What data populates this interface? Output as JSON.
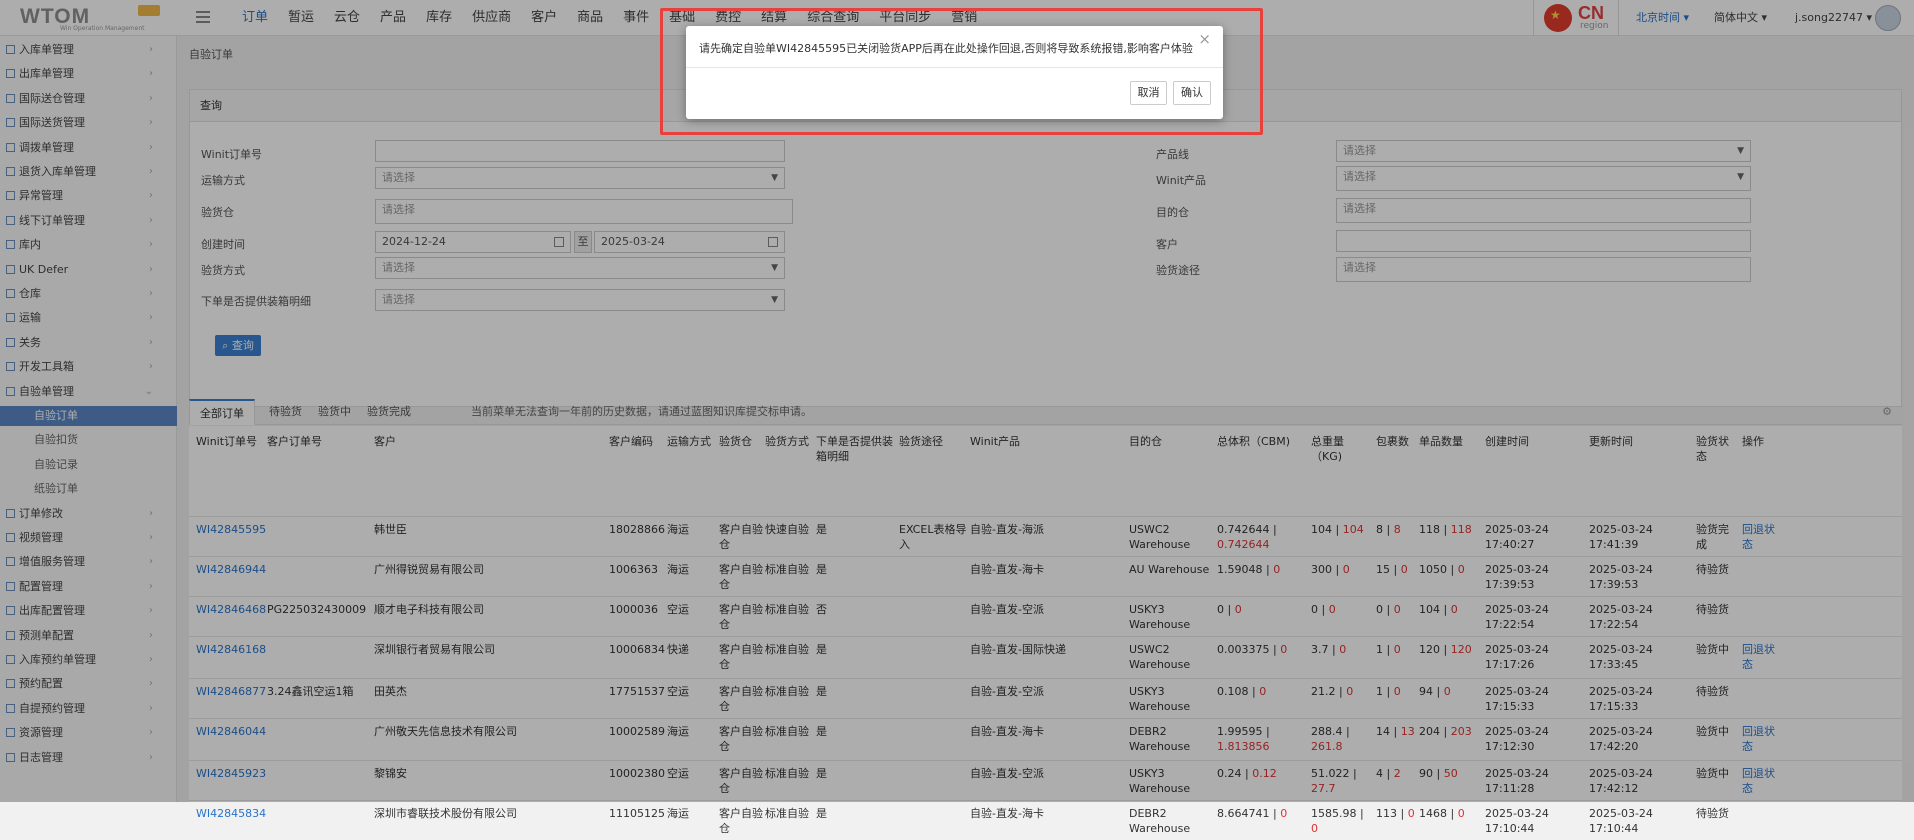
{
  "header": {
    "logo_text": "WTOM",
    "logo_subtitle": "Win Operation Management",
    "menu": [
      "订单",
      "暂运",
      "云仓",
      "产品",
      "库存",
      "供应商",
      "客户",
      "商品",
      "事件",
      "基础",
      "费控",
      "结算",
      "综合查询",
      "平台同步",
      "营销"
    ],
    "region_code": "CN",
    "region_label": "region",
    "beijing_time": "北京时间 ▾",
    "language": "简体中文 ▾",
    "user": "j.song22747 ▾"
  },
  "sidebar": {
    "items": [
      "入库单管理",
      "出库单管理",
      "国际送仓管理",
      "国际送货管理",
      "调拨单管理",
      "退货入库单管理",
      "异常管理",
      "线下订单管理",
      "库内",
      "UK Defer",
      "仓库",
      "运输",
      "关务",
      "开发工具箱",
      "自验单管理"
    ],
    "sub_items": [
      "自验订单",
      "自验扣货",
      "自验记录",
      "纸验订单"
    ],
    "items_after": [
      "订单修改",
      "视频管理",
      "增值服务管理",
      "配置管理",
      "出库配置管理",
      "预测单配置",
      "入库预约单管理",
      "预约配置",
      "自提预约管理",
      "资源管理",
      "日志管理"
    ]
  },
  "page": {
    "title": "自验订单",
    "query_panel_title": "查询",
    "fields": {
      "winit_order": "Winit订单号",
      "transport": "运输方式",
      "transport_ph": "请选择",
      "inspect_wh": "验货仓",
      "inspect_wh_ph": "请选择",
      "create_time": "创建时间",
      "date_from": "2024-12-24",
      "date_sep": "至",
      "date_to": "2025-03-24",
      "inspect_method": "验货方式",
      "inspect_method_ph": "请选择",
      "packing_detail": "下单是否提供装箱明细",
      "packing_detail_ph": "请选择",
      "product_line": "产品线",
      "product_line_ph": "请选择",
      "winit_product": "Winit产品",
      "winit_product_ph": "请选择",
      "dest_wh": "目的仓",
      "dest_wh_ph": "请选择",
      "customer": "客户",
      "inspect_path": "验货途径",
      "inspect_path_ph": "请选择"
    },
    "query_button": "查询"
  },
  "tabs": {
    "items": [
      "全部订单",
      "待验货",
      "验货中",
      "验货完成"
    ],
    "hint": "当前菜单无法查询一年前的历史数据，请通过蓝图知识库提交标申请。"
  },
  "table": {
    "headers": [
      "Winit订单号",
      "客户订单号",
      "客户",
      "客户编码",
      "运输方式",
      "验货仓",
      "验货方式",
      "下单是否提供装箱明细",
      "验货途径",
      "Winit产品",
      "目的仓",
      "总体积（CBM)",
      "总重量（KG)",
      "包裹数",
      "单品数量",
      "创建时间",
      "更新时间",
      "验货状态",
      "操作"
    ],
    "rows": [
      {
        "order": "WI42845595",
        "cust_order": "",
        "customer": "韩世臣",
        "code": "18028866",
        "transport": "海运",
        "wh": "客户自验仓",
        "method": "快速自验",
        "packing": "是",
        "path": "EXCEL表格导入",
        "product": "自验-直发-海派",
        "dest": "USWC2 Warehouse",
        "vol_a": "0.742644",
        "vol_b": "0.742644",
        "wt_a": "104",
        "wt_b": "104",
        "pkg_a": "8",
        "pkg_b": "8",
        "qty_a": "118",
        "qty_b": "118",
        "created": "2025-03-24 17:40:27",
        "updated": "2025-03-24 17:41:39",
        "status": "验货完成",
        "op": "回退状态"
      },
      {
        "order": "WI42846944",
        "cust_order": "",
        "customer": "广州得锐贸易有限公司",
        "code": "1006363",
        "transport": "海运",
        "wh": "客户自验仓",
        "method": "标准自验",
        "packing": "是",
        "path": "",
        "product": "自验-直发-海卡",
        "dest": "AU Warehouse",
        "vol_a": "1.59048",
        "vol_b": "0",
        "wt_a": "300",
        "wt_b": "0",
        "pkg_a": "15",
        "pkg_b": "0",
        "qty_a": "1050",
        "qty_b": "0",
        "created": "2025-03-24 17:39:53",
        "updated": "2025-03-24 17:39:53",
        "status": "待验货",
        "op": ""
      },
      {
        "order": "WI42846468",
        "cust_order": "PG225032430009",
        "customer": "顺才电子科技有限公司",
        "code": "1000036",
        "transport": "空运",
        "wh": "客户自验仓",
        "method": "标准自验",
        "packing": "否",
        "path": "",
        "product": "自验-直发-空派",
        "dest": "USKY3 Warehouse",
        "vol_a": "0",
        "vol_b": "0",
        "wt_a": "0",
        "wt_b": "0",
        "pkg_a": "0",
        "pkg_b": "0",
        "qty_a": "104",
        "qty_b": "0",
        "created": "2025-03-24 17:22:54",
        "updated": "2025-03-24 17:22:54",
        "status": "待验货",
        "op": ""
      },
      {
        "order": "WI42846168",
        "cust_order": "",
        "customer": "深圳银行者贸易有限公司",
        "code": "10006834",
        "transport": "快递",
        "wh": "客户自验仓",
        "method": "标准自验",
        "packing": "是",
        "path": "",
        "product": "自验-直发-国际快递",
        "dest": "USWC2 Warehouse",
        "vol_a": "0.003375",
        "vol_b": "0",
        "wt_a": "3.7",
        "wt_b": "0",
        "pkg_a": "1",
        "pkg_b": "0",
        "qty_a": "120",
        "qty_b": "120",
        "created": "2025-03-24 17:17:26",
        "updated": "2025-03-24 17:33:45",
        "status": "验货中",
        "op": "回退状态"
      },
      {
        "order": "WI42846877",
        "cust_order": "3.24鑫讯空运1箱",
        "customer": "田英杰",
        "code": "17751537",
        "transport": "空运",
        "wh": "客户自验仓",
        "method": "标准自验",
        "packing": "是",
        "path": "",
        "product": "自验-直发-空派",
        "dest": "USKY3 Warehouse",
        "vol_a": "0.108",
        "vol_b": "0",
        "wt_a": "21.2",
        "wt_b": "0",
        "pkg_a": "1",
        "pkg_b": "0",
        "qty_a": "94",
        "qty_b": "0",
        "created": "2025-03-24 17:15:33",
        "updated": "2025-03-24 17:15:33",
        "status": "待验货",
        "op": ""
      },
      {
        "order": "WI42846044",
        "cust_order": "",
        "customer": "广州敬天先信息技术有限公司",
        "code": "10002589",
        "transport": "海运",
        "wh": "客户自验仓",
        "method": "标准自验",
        "packing": "是",
        "path": "",
        "product": "自验-直发-海卡",
        "dest": "DEBR2 Warehouse",
        "vol_a": "1.99595",
        "vol_b": "1.813856",
        "wt_a": "288.4",
        "wt_b": "261.8",
        "pkg_a": "14",
        "pkg_b": "13",
        "qty_a": "204",
        "qty_b": "203",
        "created": "2025-03-24 17:12:30",
        "updated": "2025-03-24 17:42:20",
        "status": "验货中",
        "op": "回退状态"
      },
      {
        "order": "WI42845923",
        "cust_order": "",
        "customer": "黎锦安",
        "code": "10002380",
        "transport": "空运",
        "wh": "客户自验仓",
        "method": "标准自验",
        "packing": "是",
        "path": "",
        "product": "自验-直发-空派",
        "dest": "USKY3 Warehouse",
        "vol_a": "0.24",
        "vol_b": "0.12",
        "wt_a": "51.022",
        "wt_b": "27.7",
        "pkg_a": "4",
        "pkg_b": "2",
        "qty_a": "90",
        "qty_b": "50",
        "created": "2025-03-24 17:11:28",
        "updated": "2025-03-24 17:42:12",
        "status": "验货中",
        "op": "回退状态"
      },
      {
        "order": "WI42845834",
        "cust_order": "",
        "customer": "深圳市睿联技术股份有限公司",
        "code": "11105125",
        "transport": "海运",
        "wh": "客户自验仓",
        "method": "标准自验",
        "packing": "是",
        "path": "",
        "product": "自验-直发-海卡",
        "dest": "DEBR2 Warehouse",
        "vol_a": "8.664741",
        "vol_b": "0",
        "wt_a": "1585.98",
        "wt_b": "0",
        "pkg_a": "113",
        "pkg_b": "0",
        "qty_a": "1468",
        "qty_b": "0",
        "created": "2025-03-24 17:10:44",
        "updated": "2025-03-24 17:10:44",
        "status": "待验货",
        "op": ""
      }
    ]
  },
  "dialog": {
    "message": "请先确定自验单WI42845595已关闭验货APP后再在此处操作回退,否则将导致系统报错,影响客户体验",
    "cancel": "取消",
    "confirm": "确认",
    "close": "×"
  },
  "colors": {
    "accent": "#2a73c9",
    "highlight_border": "#e8413b",
    "active_menu": "#5b86c4"
  }
}
